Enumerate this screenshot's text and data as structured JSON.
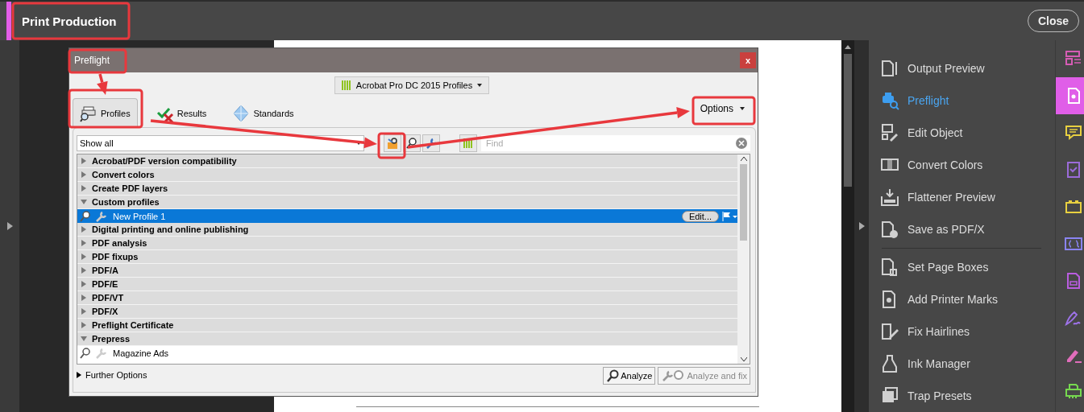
{
  "app_bar": {
    "title": "Print Production",
    "close": "Close"
  },
  "dialog": {
    "title": "Preflight",
    "close": "x",
    "library": "Acrobat Pro DC 2015 Profiles",
    "tabs": [
      {
        "label": "Profiles",
        "selected": true
      },
      {
        "label": "Results",
        "selected": false
      },
      {
        "label": "Standards",
        "selected": false
      }
    ],
    "options": "Options",
    "filter": "Show all",
    "search": {
      "placeholder": "Find"
    },
    "profiles": [
      {
        "label": "Acrobat/PDF version compatibility",
        "expanded": false
      },
      {
        "label": "Convert colors",
        "expanded": false
      },
      {
        "label": "Create PDF layers",
        "expanded": false
      },
      {
        "label": "Custom profiles",
        "expanded": true,
        "children": [
          {
            "label": "New Profile 1",
            "selected": true,
            "action": "Edit..."
          }
        ]
      },
      {
        "label": "Digital printing and online publishing",
        "expanded": false
      },
      {
        "label": "PDF analysis",
        "expanded": false
      },
      {
        "label": "PDF fixups",
        "expanded": false
      },
      {
        "label": "PDF/A",
        "expanded": false
      },
      {
        "label": "PDF/E",
        "expanded": false
      },
      {
        "label": "PDF/VT",
        "expanded": false
      },
      {
        "label": "PDF/X",
        "expanded": false
      },
      {
        "label": "Preflight Certificate",
        "expanded": false
      },
      {
        "label": "Prepress",
        "expanded": true,
        "children": [
          {
            "label": "Magazine Ads",
            "selected": false
          }
        ]
      }
    ],
    "further_options": {
      "label": "Further Options",
      "expanded": false
    },
    "buttons": [
      {
        "label": "Analyze",
        "disabled": false
      },
      {
        "label": "Analyze and fix",
        "disabled": true
      }
    ]
  },
  "tools": {
    "groups": [
      [
        {
          "label": "Output Preview",
          "selected": false
        },
        {
          "label": "Preflight",
          "selected": true
        },
        {
          "label": "Edit Object",
          "selected": false
        },
        {
          "label": "Convert Colors",
          "selected": false
        },
        {
          "label": "Flattener Preview",
          "selected": false
        },
        {
          "label": "Save as PDF/X",
          "selected": false
        }
      ],
      [
        {
          "label": "Set Page Boxes",
          "selected": false
        },
        {
          "label": "Add Printer Marks",
          "selected": false
        },
        {
          "label": "Fix Hairlines",
          "selected": false
        },
        {
          "label": "Ink Manager",
          "selected": false
        },
        {
          "label": "Trap Presets",
          "selected": false
        }
      ]
    ]
  },
  "rail": [
    {
      "color": "#d65cb4",
      "selected": false
    },
    {
      "color": "#ffffff",
      "selected": true
    },
    {
      "color": "#e8d040",
      "selected": false
    },
    {
      "color": "#9b6bd9",
      "selected": false
    },
    {
      "color": "#e8d040",
      "selected": false
    },
    {
      "color": "#8a84f2",
      "selected": false
    },
    {
      "color": "#b95de0",
      "selected": false
    },
    {
      "color": "#9d72e8",
      "selected": false
    },
    {
      "color": "#e06dbb",
      "selected": false
    },
    {
      "color": "#76d84f",
      "selected": false
    }
  ]
}
